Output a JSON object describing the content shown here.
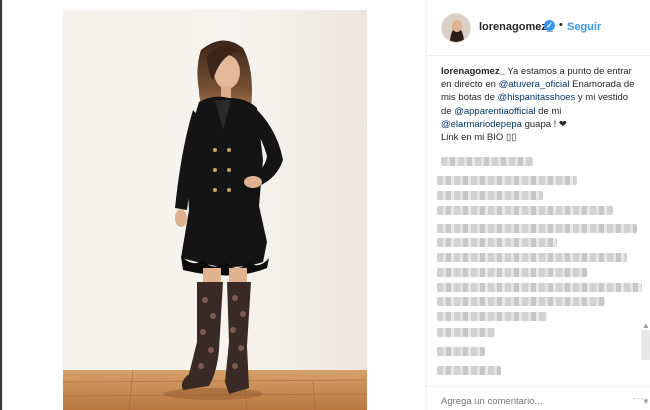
{
  "post": {
    "username": "lorenagomez_",
    "verified": true,
    "separator": "•",
    "follow_label": "Seguir",
    "caption": {
      "author": "lorenagomez_",
      "text_1": " Ya estamos a punto de entrar en directo en ",
      "mention_1": "@atuvera_oficial",
      "text_2": " Enamorada de mis botas de ",
      "mention_2": "@hispanitasshoes",
      "text_3": " y mi vestido de ",
      "mention_3": "@apparentiaofficial",
      "text_4": " de mi ",
      "mention_4": "@elarmariodepepa",
      "text_5": " guapa ! ❤",
      "text_6": "Link en mi BIO ▯▯"
    },
    "comment_placeholder": "Agrega un comentario...",
    "more_options": "..."
  },
  "colors": {
    "link": "#003569",
    "follow": "#3897f0",
    "border": "#efefef"
  },
  "icons": {
    "verified": "verified-badge-icon",
    "more": "more-options-icon"
  }
}
